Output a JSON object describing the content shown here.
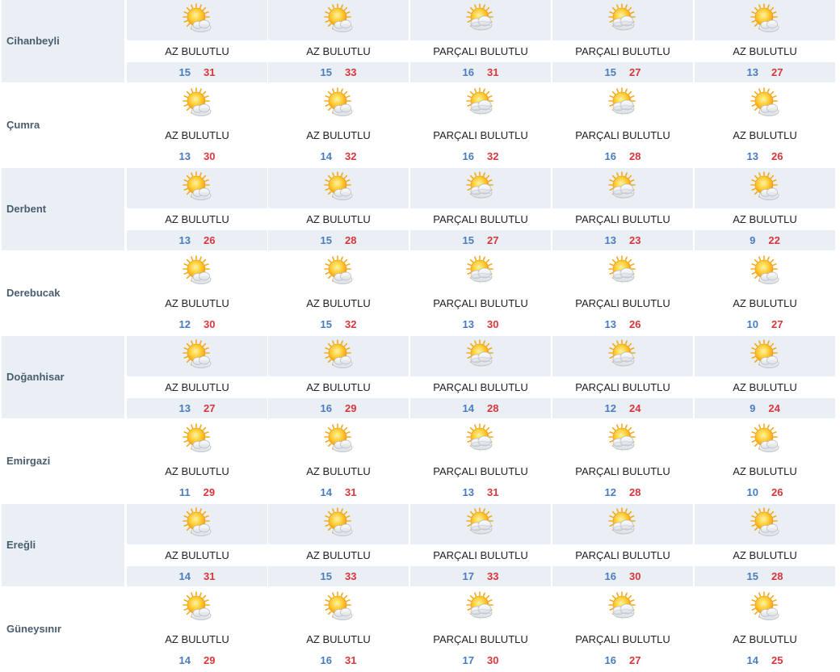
{
  "colors": {
    "row_bg_alt": "#e9eff4",
    "temp_low": "#4a7cc0",
    "temp_high": "#d9363b",
    "city_text": "#4a5d6e"
  },
  "icons": {
    "AZ BULUTLU": "sun-mostly-clear-icon",
    "PARÇALI BULUTLU": "sun-partly-cloudy-icon"
  },
  "cities": [
    {
      "name": "Cihanbeyli",
      "days": [
        {
          "desc": "AZ BULUTLU",
          "low": "15",
          "high": "31"
        },
        {
          "desc": "AZ BULUTLU",
          "low": "15",
          "high": "33"
        },
        {
          "desc": "PARÇALI BULUTLU",
          "low": "16",
          "high": "31"
        },
        {
          "desc": "PARÇALI BULUTLU",
          "low": "15",
          "high": "27"
        },
        {
          "desc": "AZ BULUTLU",
          "low": "13",
          "high": "27"
        }
      ]
    },
    {
      "name": "Çumra",
      "days": [
        {
          "desc": "AZ BULUTLU",
          "low": "13",
          "high": "30"
        },
        {
          "desc": "AZ BULUTLU",
          "low": "14",
          "high": "32"
        },
        {
          "desc": "PARÇALI BULUTLU",
          "low": "16",
          "high": "32"
        },
        {
          "desc": "PARÇALI BULUTLU",
          "low": "16",
          "high": "28"
        },
        {
          "desc": "AZ BULUTLU",
          "low": "13",
          "high": "26"
        }
      ]
    },
    {
      "name": "Derbent",
      "days": [
        {
          "desc": "AZ BULUTLU",
          "low": "13",
          "high": "26"
        },
        {
          "desc": "AZ BULUTLU",
          "low": "15",
          "high": "28"
        },
        {
          "desc": "PARÇALI BULUTLU",
          "low": "15",
          "high": "27"
        },
        {
          "desc": "PARÇALI BULUTLU",
          "low": "13",
          "high": "23"
        },
        {
          "desc": "AZ BULUTLU",
          "low": "9",
          "high": "22"
        }
      ]
    },
    {
      "name": "Derebucak",
      "days": [
        {
          "desc": "AZ BULUTLU",
          "low": "12",
          "high": "30"
        },
        {
          "desc": "AZ BULUTLU",
          "low": "15",
          "high": "32"
        },
        {
          "desc": "PARÇALI BULUTLU",
          "low": "13",
          "high": "30"
        },
        {
          "desc": "PARÇALI BULUTLU",
          "low": "13",
          "high": "26"
        },
        {
          "desc": "AZ BULUTLU",
          "low": "10",
          "high": "27"
        }
      ]
    },
    {
      "name": "Doğanhisar",
      "days": [
        {
          "desc": "AZ BULUTLU",
          "low": "13",
          "high": "27"
        },
        {
          "desc": "AZ BULUTLU",
          "low": "16",
          "high": "29"
        },
        {
          "desc": "PARÇALI BULUTLU",
          "low": "14",
          "high": "28"
        },
        {
          "desc": "PARÇALI BULUTLU",
          "low": "12",
          "high": "24"
        },
        {
          "desc": "AZ BULUTLU",
          "low": "9",
          "high": "24"
        }
      ]
    },
    {
      "name": "Emirgazi",
      "days": [
        {
          "desc": "AZ BULUTLU",
          "low": "11",
          "high": "29"
        },
        {
          "desc": "AZ BULUTLU",
          "low": "14",
          "high": "31"
        },
        {
          "desc": "PARÇALI BULUTLU",
          "low": "13",
          "high": "31"
        },
        {
          "desc": "PARÇALI BULUTLU",
          "low": "12",
          "high": "28"
        },
        {
          "desc": "AZ BULUTLU",
          "low": "10",
          "high": "26"
        }
      ]
    },
    {
      "name": "Ereğli",
      "days": [
        {
          "desc": "AZ BULUTLU",
          "low": "14",
          "high": "31"
        },
        {
          "desc": "AZ BULUTLU",
          "low": "15",
          "high": "33"
        },
        {
          "desc": "PARÇALI BULUTLU",
          "low": "17",
          "high": "33"
        },
        {
          "desc": "PARÇALI BULUTLU",
          "low": "16",
          "high": "30"
        },
        {
          "desc": "AZ BULUTLU",
          "low": "15",
          "high": "28"
        }
      ]
    },
    {
      "name": "Güneysınır",
      "days": [
        {
          "desc": "AZ BULUTLU",
          "low": "14",
          "high": "29"
        },
        {
          "desc": "AZ BULUTLU",
          "low": "16",
          "high": "31"
        },
        {
          "desc": "PARÇALI BULUTLU",
          "low": "17",
          "high": "30"
        },
        {
          "desc": "PARÇALI BULUTLU",
          "low": "16",
          "high": "27"
        },
        {
          "desc": "AZ BULUTLU",
          "low": "14",
          "high": "25"
        }
      ]
    }
  ]
}
